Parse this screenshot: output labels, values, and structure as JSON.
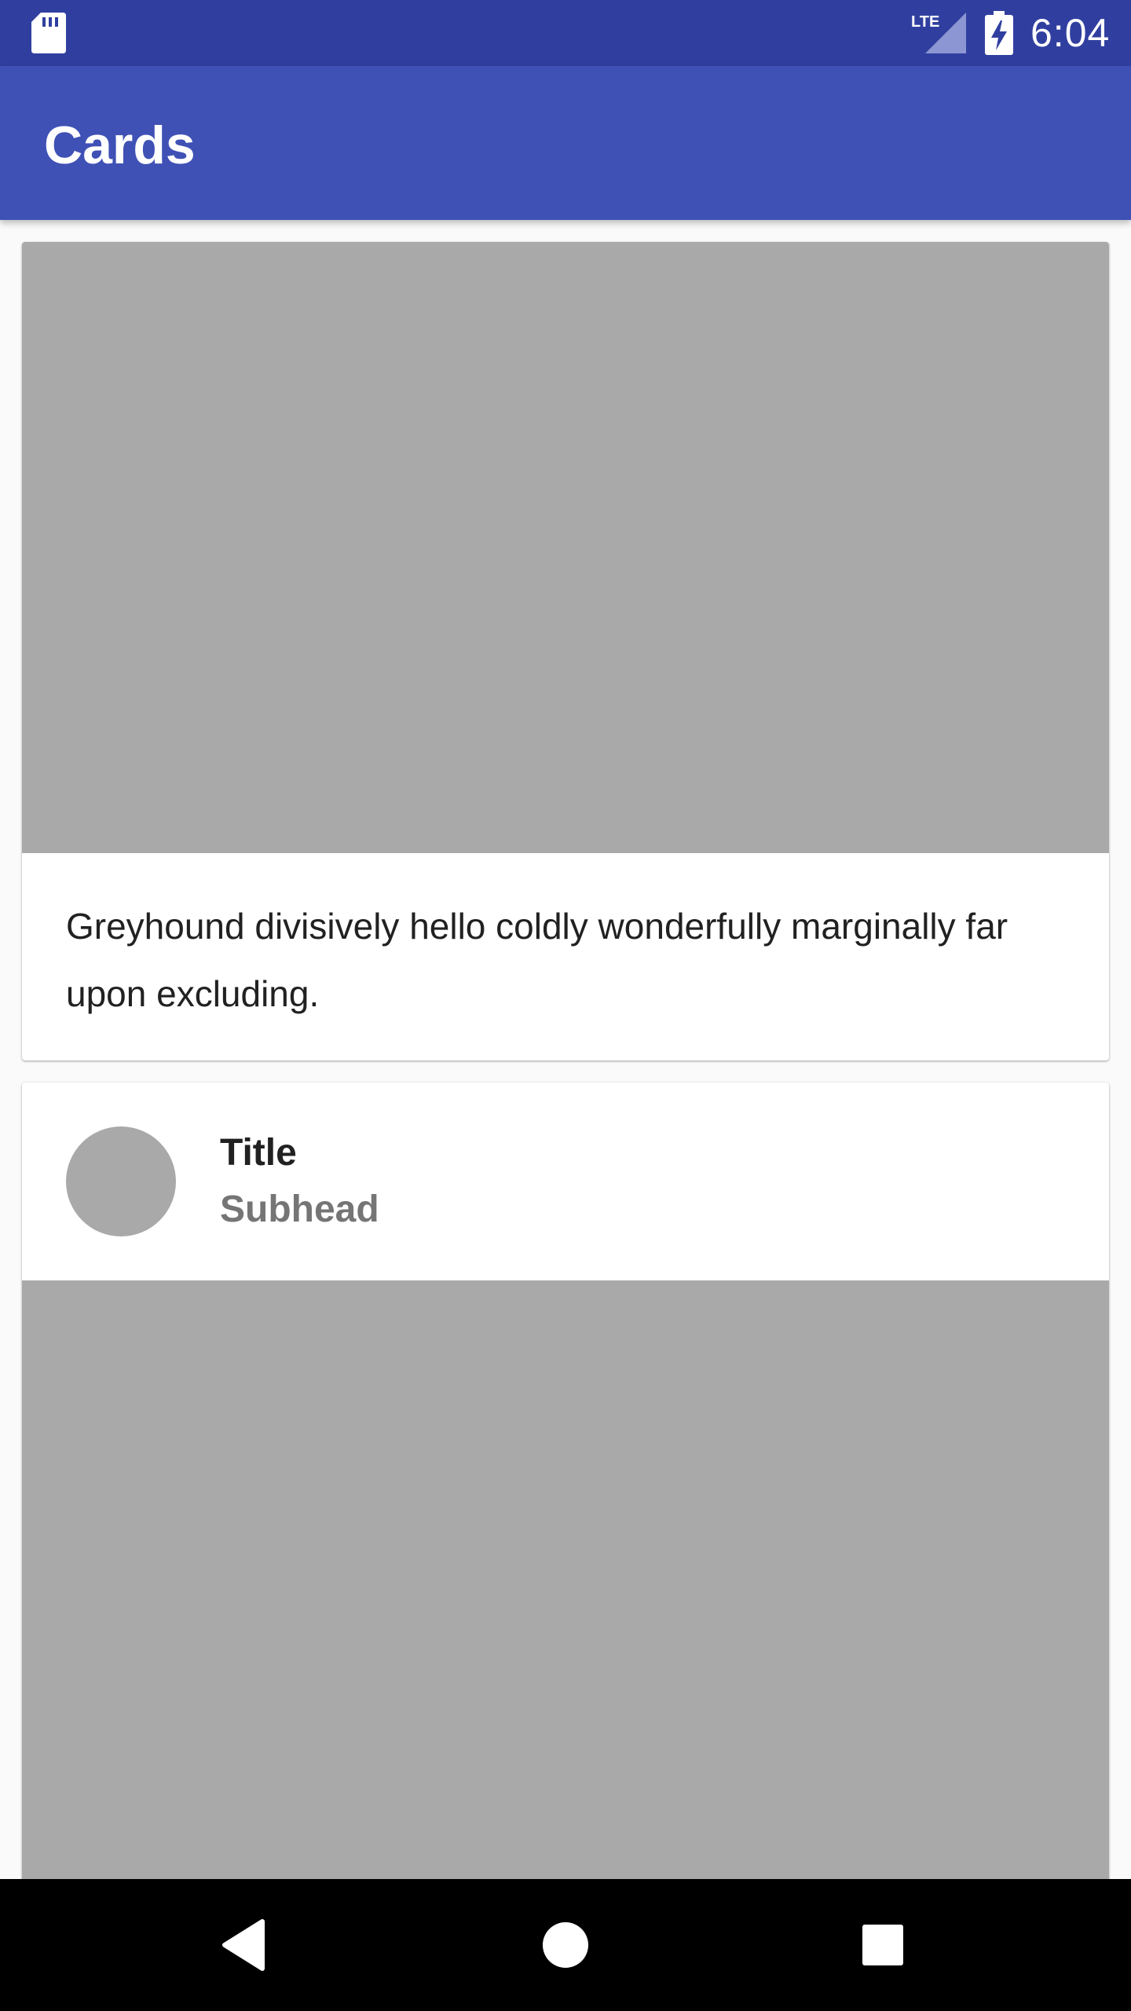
{
  "status_bar": {
    "time": "6:04",
    "network": "LTE",
    "icons": [
      "sd-card-icon",
      "lte-signal-icon",
      "battery-charging-icon"
    ]
  },
  "app_bar": {
    "title": "Cards"
  },
  "cards": [
    {
      "media": "image-placeholder",
      "text": "Greyhound divisively hello coldly wonderfully marginally far upon excluding."
    },
    {
      "avatar": "avatar-placeholder",
      "title": "Title",
      "subhead": "Subhead",
      "media": "image-placeholder"
    }
  ],
  "nav_bar": {
    "buttons": [
      "back-icon",
      "home-icon",
      "recents-icon"
    ]
  },
  "colors": {
    "status_bar": "#303f9f",
    "app_bar": "#3f51b5",
    "placeholder": "#a9a9a9",
    "background": "#fafafa"
  }
}
